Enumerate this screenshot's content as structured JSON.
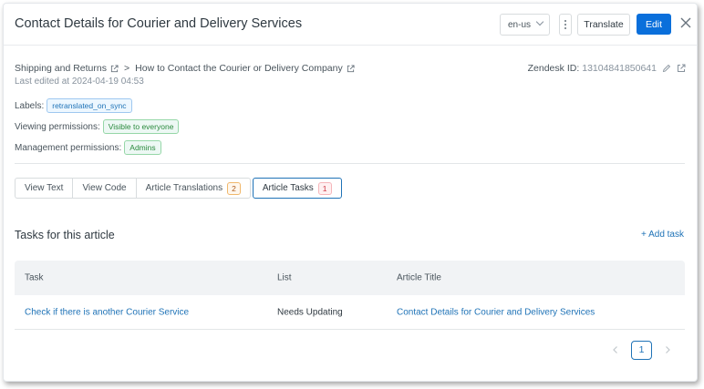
{
  "header": {
    "title": "Contact Details for Courier and Delivery Services",
    "language": "en-us",
    "translate_label": "Translate",
    "edit_label": "Edit"
  },
  "meta": {
    "breadcrumb": [
      "Shipping and Returns",
      "How to Contact the Courier or Delivery Company"
    ],
    "breadcrumb_sep": ">",
    "last_edited": "Last edited at 2024-04-19 04:53",
    "zendesk_label": "Zendesk ID:",
    "zendesk_id": "13104841850641",
    "labels_label": "Labels:",
    "labels_value": "retranslated_on_sync",
    "viewing_label": "Viewing permissions:",
    "viewing_value": "Visible to everyone",
    "management_label": "Management permissions:",
    "management_value": "Admins"
  },
  "tabs": [
    {
      "label": "View Text"
    },
    {
      "label": "View Code"
    },
    {
      "label": "Article Translations",
      "count": "2"
    },
    {
      "label": "Article Tasks",
      "count": "1"
    }
  ],
  "tasks": {
    "title": "Tasks for this article",
    "add_label": "+ Add task",
    "columns": [
      "Task",
      "List",
      "Article Title"
    ],
    "rows": [
      {
        "task": "Check if there is another Courier Service",
        "list": "Needs Updating",
        "article": "Contact Details for Courier and Delivery Services"
      }
    ]
  },
  "pagination": {
    "current": "1"
  },
  "colors": {
    "accent": "#1f73b7",
    "edit_button": "#0a6fdb"
  },
  "icons": [
    "external-link-icon",
    "pencil-icon",
    "close-icon",
    "chevron-down-icon",
    "kebab-menu-icon",
    "chevron-left-icon",
    "chevron-right-icon"
  ]
}
